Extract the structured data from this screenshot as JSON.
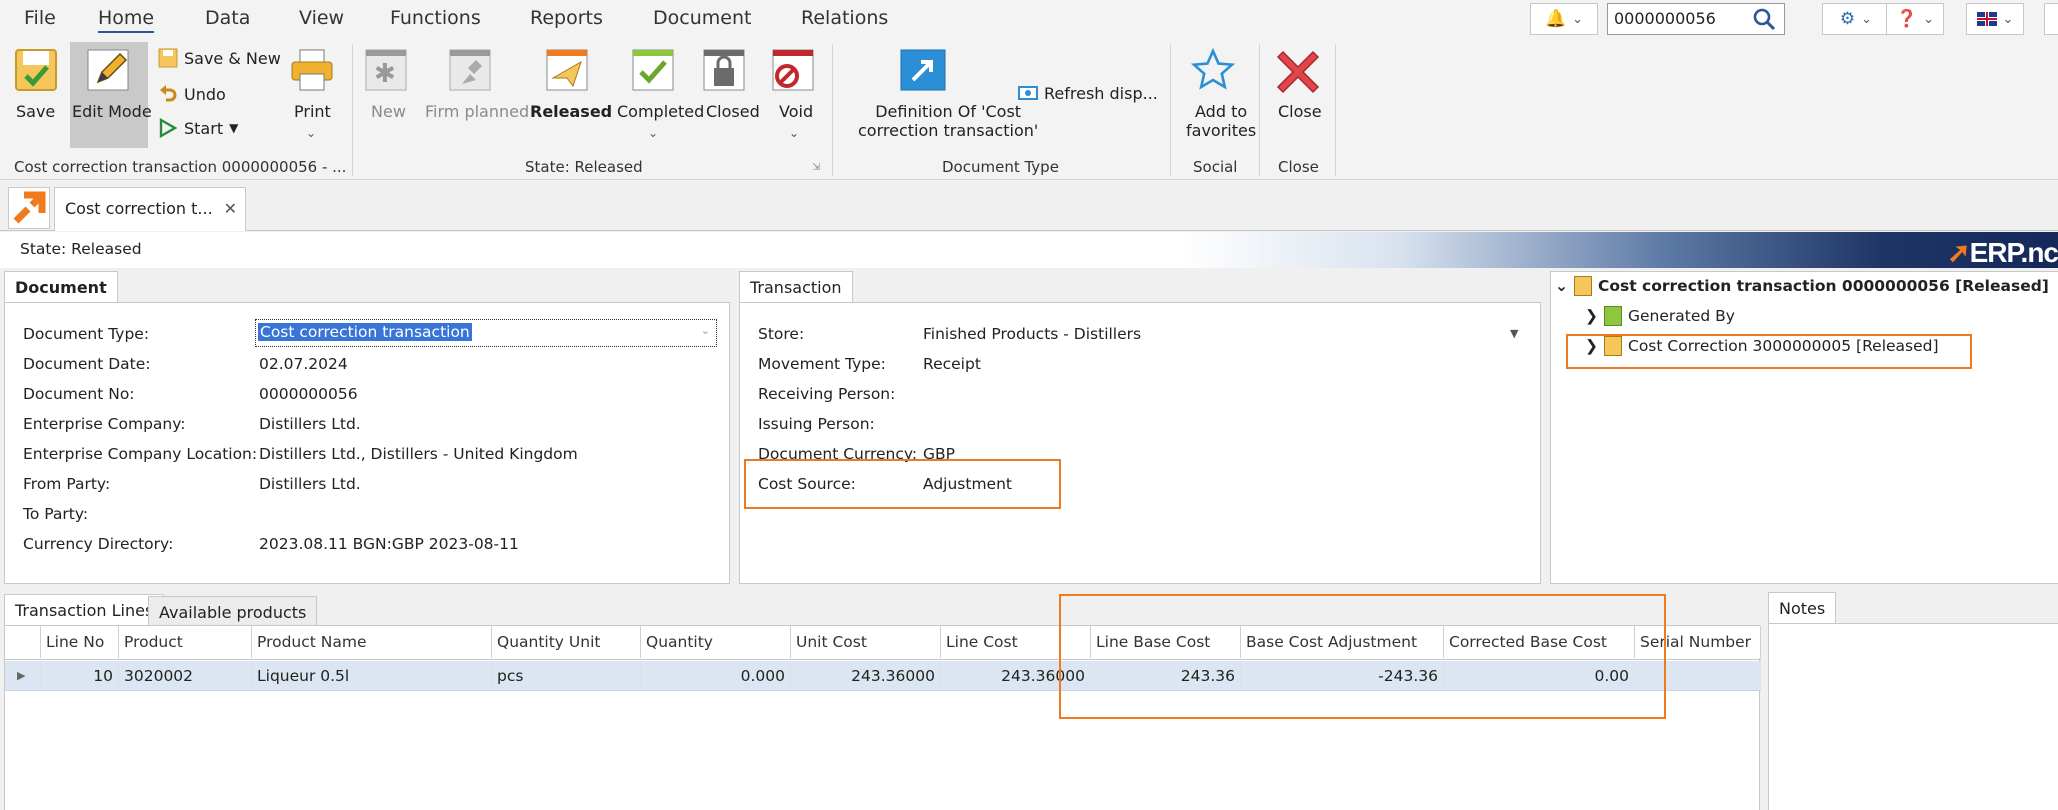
{
  "menu": [
    "File",
    "Home",
    "Data",
    "View",
    "Functions",
    "Reports",
    "Document",
    "Relations"
  ],
  "search": {
    "value": "0000000056"
  },
  "ribbon": {
    "save": "Save",
    "edit_mode": "Edit Mode",
    "save_new": "Save & New",
    "undo": "Undo",
    "start": "Start",
    "print": "Print",
    "new": "New",
    "firm_planned": "Firm planned",
    "released": "Released",
    "completed": "Completed",
    "closed": "Closed",
    "void": "Void",
    "definition_line1": "Definition Of 'Cost",
    "definition_line2": "correction transaction'",
    "refresh": "Refresh disp...",
    "add_fav_line1": "Add to",
    "add_fav_line2": "favorites",
    "close": "Close",
    "group_doc": "Cost correction transaction 0000000056 - ...",
    "group_state": "State: Released",
    "group_doctype": "Document Type",
    "group_social": "Social",
    "group_close": "Close"
  },
  "doc_tab": {
    "label": "Cost correction t..."
  },
  "state_text": "State: Released",
  "logo_text": "ERP.nc",
  "document_panel": {
    "tab": "Document",
    "fields": [
      {
        "label": "Document Type:",
        "value": "Cost correction transaction"
      },
      {
        "label": "Document Date:",
        "value": "02.07.2024"
      },
      {
        "label": "Document No:",
        "value": "0000000056"
      },
      {
        "label": "Enterprise Company:",
        "value": "Distillers Ltd."
      },
      {
        "label": "Enterprise Company Location:",
        "value": "Distillers Ltd., Distillers - United Kingdom"
      },
      {
        "label": "From Party:",
        "value": "Distillers Ltd."
      },
      {
        "label": "To Party:",
        "value": ""
      },
      {
        "label": "Currency Directory:",
        "value": "2023.08.11 BGN:GBP 2023-08-11"
      }
    ]
  },
  "transaction_panel": {
    "tab": "Transaction",
    "fields": [
      {
        "label": "Store:",
        "value": "Finished Products - Distillers"
      },
      {
        "label": "Movement Type:",
        "value": "Receipt"
      },
      {
        "label": "Receiving Person:",
        "value": ""
      },
      {
        "label": "Issuing Person:",
        "value": ""
      },
      {
        "label": "Document Currency:",
        "value": "GBP"
      },
      {
        "label": "Cost Source:",
        "value": "Adjustment"
      }
    ]
  },
  "tree": {
    "root": "Cost correction transaction 0000000056 [Released]",
    "children": [
      "Generated By",
      "Cost Correction 3000000005 [Released]"
    ]
  },
  "lines_tabs": [
    "Transaction Lines",
    "Available products"
  ],
  "notes_tab": "Notes",
  "grid": {
    "columns": [
      "Line No",
      "Product",
      "Product Name",
      "Quantity Unit",
      "Quantity",
      "Unit Cost",
      "Line Cost",
      "Line Base Cost",
      "Base Cost Adjustment",
      "Corrected Base Cost",
      "Serial Number"
    ],
    "rows": [
      [
        "10",
        "3020002",
        "Liqueur 0.5l",
        "pcs",
        "0.000",
        "243.36000",
        "243.36000",
        "243.36",
        "-243.36",
        "0.00",
        ""
      ]
    ]
  },
  "colors": {
    "highlight": "#f07a1e",
    "accent": "#2b5797",
    "selection": "#3875d7"
  }
}
